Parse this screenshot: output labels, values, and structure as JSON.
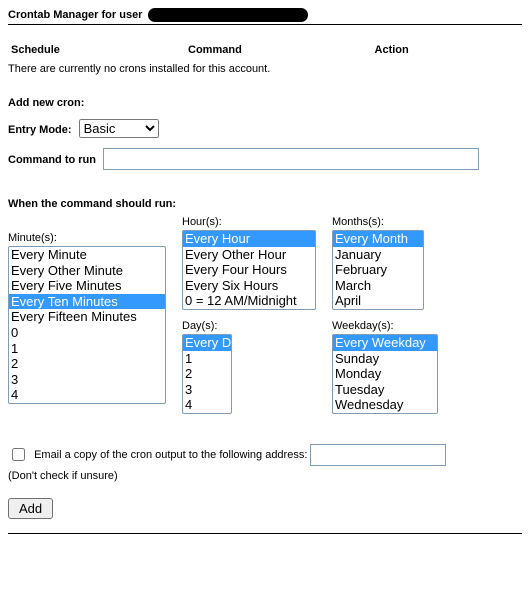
{
  "title_prefix": "Crontab Manager for user",
  "table": {
    "h1": "Schedule",
    "h2": "Command",
    "h3": "Action"
  },
  "no_crons": "There are currently no crons installed for this account.",
  "add_hdr": "Add new cron:",
  "entry_mode_label": "Entry Mode:",
  "entry_mode_value": "Basic",
  "cmd_label": "Command to run",
  "run_hdr": "When the command should run:",
  "labels": {
    "min": "Minute(s):",
    "hour": "Hour(s):",
    "day": "Day(s):",
    "month": "Months(s):",
    "weekday": "Weekday(s):"
  },
  "minutes": [
    "Every Minute",
    "Every Other Minute",
    "Every Five Minutes",
    "Every Ten Minutes",
    "Every Fifteen Minutes",
    "0",
    "1",
    "2",
    "3",
    "4"
  ],
  "minutes_selected": "Every Ten Minutes",
  "hours": [
    "Every Hour",
    "Every Other Hour",
    "Every Four Hours",
    "Every Six Hours",
    "0 = 12 AM/Midnight"
  ],
  "hours_selected": "Every Hour",
  "days": [
    "Every Day",
    "1",
    "2",
    "3",
    "4"
  ],
  "days_selected": "Every Day",
  "months": [
    "Every Month",
    "January",
    "February",
    "March",
    "April"
  ],
  "months_selected": "Every Month",
  "weekdays": [
    "Every Weekday",
    "Sunday",
    "Monday",
    "Tuesday",
    "Wednesday"
  ],
  "weekdays_selected": "Every Weekday",
  "email_label": "Email a copy of the cron output to the following address:",
  "email_note": "(Don't check if unsure)",
  "add_btn": "Add"
}
